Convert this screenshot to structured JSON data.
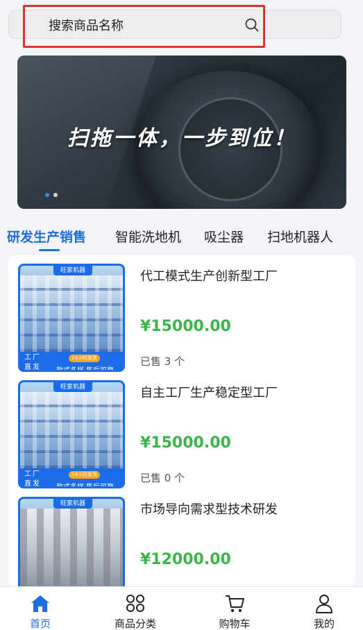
{
  "search": {
    "placeholder": "搜索商品名称",
    "icon": "search-icon"
  },
  "banner": {
    "headline": "扫拖一体，一步到位！",
    "slides": 2,
    "active_slide": 1
  },
  "tabs": [
    {
      "label": "研发生产销售",
      "active": true
    },
    {
      "label": "智能洗地机",
      "active": false
    },
    {
      "label": "吸尘器",
      "active": false
    },
    {
      "label": "扫地机器人",
      "active": false
    }
  ],
  "products": [
    {
      "title": "代工模式生产创新型工厂",
      "price": "¥15000.00",
      "sold": "已售 3 个",
      "thumb": {
        "brand": "旺家机器",
        "factory_label": "工厂直发",
        "badge": "24小时发货",
        "tagline": "款式多样 售后可靠"
      }
    },
    {
      "title": "自主工厂生产稳定型工厂",
      "price": "¥15000.00",
      "sold": "已售 0 个",
      "thumb": {
        "brand": "旺家机器",
        "factory_label": "工厂直发",
        "badge": "24小时发货",
        "tagline": "款式多样 售后可靠"
      }
    },
    {
      "title": "市场导向需求型技术研发",
      "price": "¥12000.00",
      "thumb": {
        "brand": "旺家机器"
      }
    }
  ],
  "tabbar": [
    {
      "label": "首页",
      "icon": "home-icon",
      "active": true
    },
    {
      "label": "商品分类",
      "icon": "category-icon",
      "active": false
    },
    {
      "label": "购物车",
      "icon": "cart-icon",
      "active": false
    },
    {
      "label": "我的",
      "icon": "user-icon",
      "active": false
    }
  ],
  "colors": {
    "accent": "#1e6fd9",
    "price": "#3bb54a",
    "highlight": "#e0322c"
  }
}
